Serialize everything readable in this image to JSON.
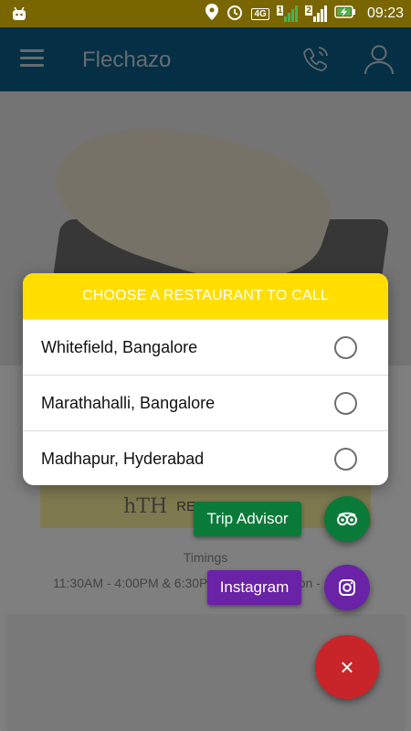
{
  "status_bar": {
    "time": "09:23",
    "network_label": "4G",
    "sim1_label": "1",
    "sim2_label": "2",
    "icons": [
      "android-icon",
      "location-icon",
      "alarm-icon",
      "signal-icon",
      "battery-charging-icon"
    ]
  },
  "app_bar": {
    "title": "Flechazo",
    "icons": [
      "menu-icon",
      "phone-call-icon",
      "user-icon"
    ]
  },
  "background": {
    "reserve_label": "RESERVE TABLE",
    "reserve_logo": "hTH",
    "timings_label": "Timings",
    "timings_value": "11:30AM - 4:00PM & 6:30PM - 11:00PM (Mon - Sun)"
  },
  "dialog": {
    "title": "CHOOSE A RESTAURANT TO CALL",
    "options": [
      {
        "label": "Whitefield, Bangalore",
        "selected": false
      },
      {
        "label": "Marathahalli, Bangalore",
        "selected": false
      },
      {
        "label": "Madhapur, Hyderabad",
        "selected": false
      }
    ]
  },
  "fab_menu": {
    "trip_advisor_label": "Trip Advisor",
    "instagram_label": "Instagram",
    "close_label": "×",
    "icons": [
      "tripadvisor-icon",
      "instagram-icon",
      "close-icon"
    ]
  },
  "colors": {
    "status_bar": "#7a6600",
    "app_bar": "#0b5f88",
    "dialog_header": "#ffde00",
    "trip_advisor": "#0a7a39",
    "instagram": "#6a22a6",
    "close_fab": "#c7252a"
  }
}
